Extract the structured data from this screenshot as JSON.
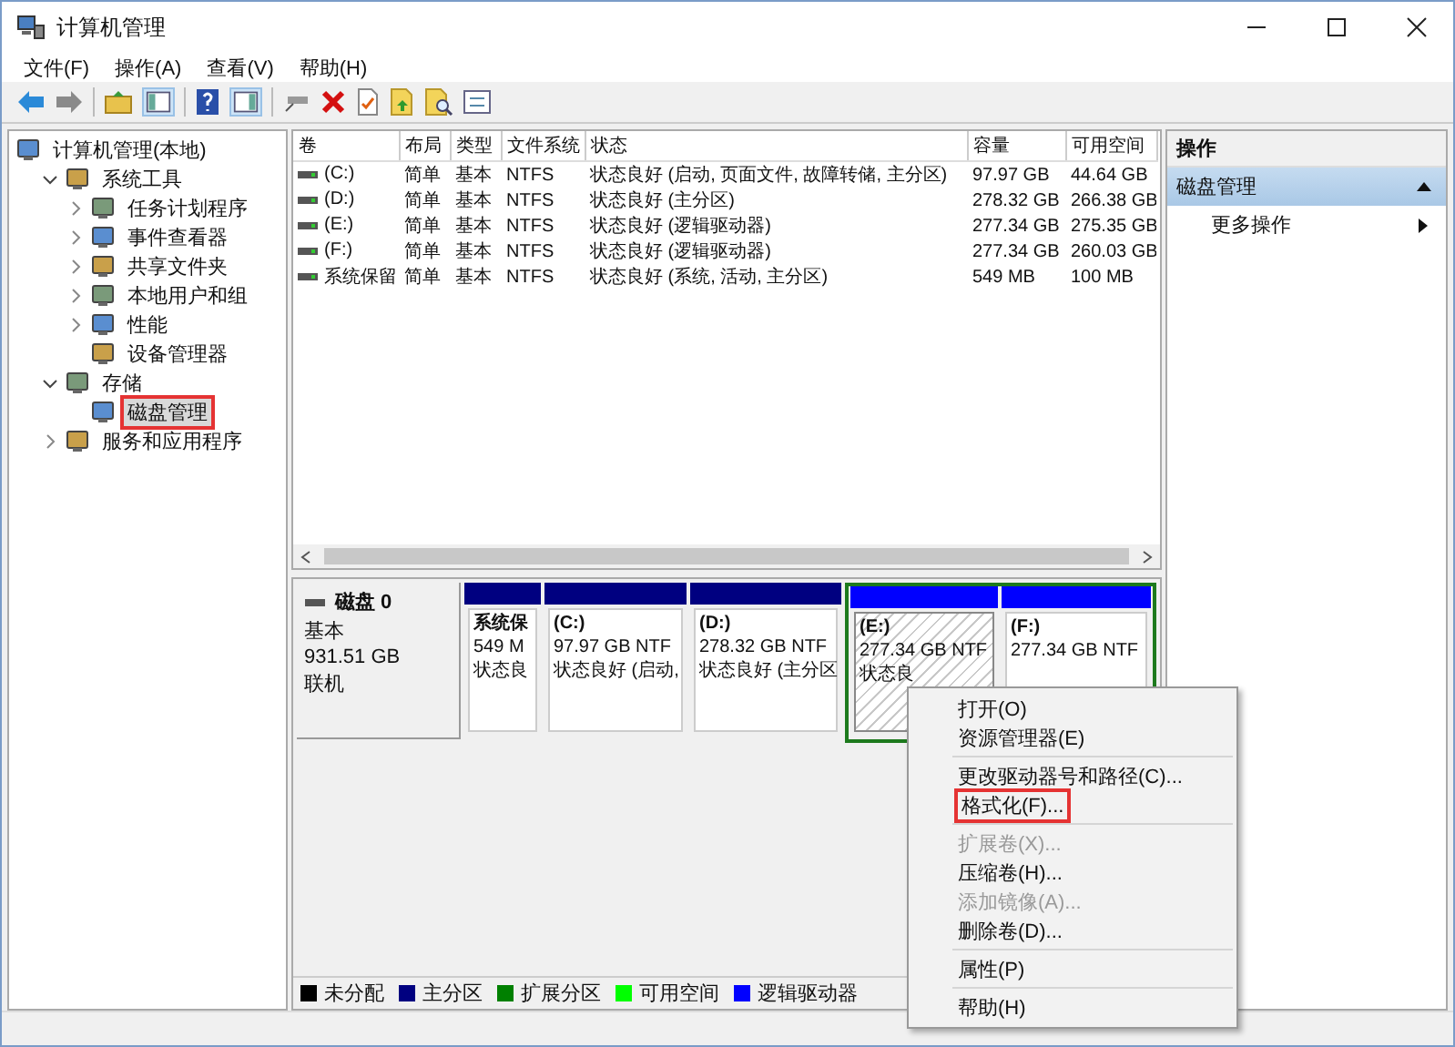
{
  "window": {
    "title": "计算机管理"
  },
  "menu": [
    "文件(F)",
    "操作(A)",
    "查看(V)",
    "帮助(H)"
  ],
  "tree": {
    "label": "计算机管理(本地)",
    "selected": false,
    "marked": false,
    "children": [
      {
        "label": "系统工具",
        "expanded": true,
        "selected": false,
        "marked": false,
        "children": [
          {
            "label": "任务计划程序",
            "expanded": false,
            "selected": false,
            "marked": false
          },
          {
            "label": "事件查看器",
            "expanded": false,
            "selected": false,
            "marked": false
          },
          {
            "label": "共享文件夹",
            "expanded": false,
            "selected": false,
            "marked": false
          },
          {
            "label": "本地用户和组",
            "expanded": false,
            "selected": false,
            "marked": false
          },
          {
            "label": "性能",
            "expanded": false,
            "selected": false,
            "marked": false
          },
          {
            "label": "设备管理器",
            "selected": false,
            "marked": false
          }
        ]
      },
      {
        "label": "存储",
        "expanded": true,
        "selected": false,
        "marked": false,
        "children": [
          {
            "label": "磁盘管理",
            "selected": true,
            "marked": true
          }
        ]
      },
      {
        "label": "服务和应用程序",
        "expanded": false,
        "selected": false,
        "marked": false
      }
    ]
  },
  "table": {
    "columns": [
      "卷",
      "布局",
      "类型",
      "文件系统",
      "状态",
      "容量",
      "可用空间"
    ],
    "rows": [
      {
        "cells": [
          "(C:)",
          "简单",
          "基本",
          "NTFS",
          "状态良好 (启动, 页面文件, 故障转储, 主分区)",
          "97.97 GB",
          "44.64 GB"
        ]
      },
      {
        "cells": [
          "(D:)",
          "简单",
          "基本",
          "NTFS",
          "状态良好 (主分区)",
          "278.32 GB",
          "266.38 GB"
        ]
      },
      {
        "cells": [
          "(E:)",
          "简单",
          "基本",
          "NTFS",
          "状态良好 (逻辑驱动器)",
          "277.34 GB",
          "275.35 GB"
        ]
      },
      {
        "cells": [
          "(F:)",
          "简单",
          "基本",
          "NTFS",
          "状态良好 (逻辑驱动器)",
          "277.34 GB",
          "260.03 GB"
        ]
      },
      {
        "cells": [
          "系统保留",
          "简单",
          "基本",
          "NTFS",
          "状态良好 (系统, 活动, 主分区)",
          "549 MB",
          "100 MB"
        ]
      }
    ]
  },
  "disk": {
    "name": "磁盘 0",
    "type": "基本",
    "size": "931.51 GB",
    "status": "联机",
    "partitions": [
      {
        "kind": "primary",
        "selected": false,
        "lines": [
          "系统保",
          "549 M",
          "状态良"
        ]
      },
      {
        "kind": "primary",
        "selected": false,
        "lines": [
          "(C:)",
          "97.97 GB NTF",
          "状态良好 (启动,"
        ]
      },
      {
        "kind": "primary",
        "selected": false,
        "lines": [
          "(D:)",
          "278.32 GB NTF",
          "状态良好 (主分区"
        ]
      },
      {
        "kind": "extended",
        "selected": false,
        "children": [
          {
            "kind": "logical",
            "selected": true,
            "lines": [
              "(E:)",
              "277.34 GB NTF",
              "状态良"
            ]
          },
          {
            "kind": "logical",
            "selected": false,
            "lines": [
              "(F:)",
              "277.34 GB NTF"
            ]
          }
        ]
      }
    ]
  },
  "legend": [
    {
      "label": "未分配",
      "color": "#000000"
    },
    {
      "label": "主分区",
      "color": "#000080"
    },
    {
      "label": "扩展分区",
      "color": "#008000"
    },
    {
      "label": "可用空间",
      "color": "#00ff00"
    },
    {
      "label": "逻辑驱动器",
      "color": "#0000ff"
    }
  ],
  "actions": {
    "header": "操作",
    "section": "磁盘管理",
    "items": [
      "更多操作"
    ]
  },
  "context_menu": [
    {
      "kind": "item",
      "label": "打开(O)",
      "disabled": false,
      "marked": false
    },
    {
      "kind": "item",
      "label": "资源管理器(E)",
      "disabled": false,
      "marked": false
    },
    {
      "kind": "separator"
    },
    {
      "kind": "item",
      "label": "更改驱动器号和路径(C)...",
      "disabled": false,
      "marked": false
    },
    {
      "kind": "item",
      "label": "格式化(F)...",
      "disabled": false,
      "marked": true
    },
    {
      "kind": "separator"
    },
    {
      "kind": "item",
      "label": "扩展卷(X)...",
      "disabled": true,
      "marked": false
    },
    {
      "kind": "item",
      "label": "压缩卷(H)...",
      "disabled": false,
      "marked": false
    },
    {
      "kind": "item",
      "label": "添加镜像(A)...",
      "disabled": true,
      "marked": false
    },
    {
      "kind": "item",
      "label": "删除卷(D)...",
      "disabled": false,
      "marked": false
    },
    {
      "kind": "separator"
    },
    {
      "kind": "item",
      "label": "属性(P)",
      "disabled": false,
      "marked": false
    },
    {
      "kind": "separator"
    },
    {
      "kind": "item",
      "label": "帮助(H)",
      "disabled": false,
      "marked": false
    }
  ]
}
